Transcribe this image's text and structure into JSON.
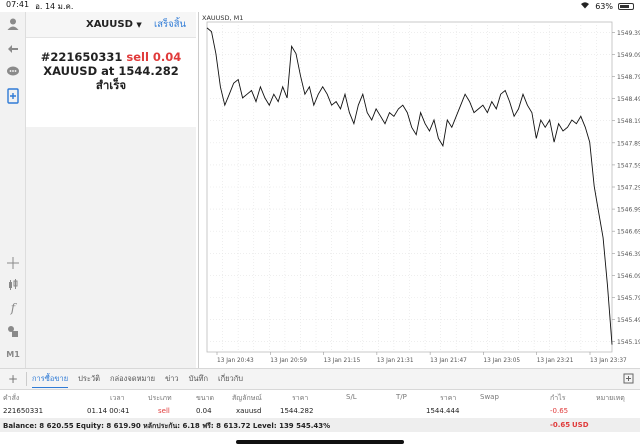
{
  "status_bar": {
    "time": "07:41",
    "date": "อ. 14 ม.ค.",
    "battery": "63%"
  },
  "order_panel": {
    "symbol": "XAUUSD",
    "done_label": "เสร็จสิ้น",
    "ticket": "#221650331",
    "action": "sell 0.04",
    "symbol_at": "XAUUSD at",
    "price": "1544.282",
    "status": "สำเร็จ"
  },
  "tools": {
    "icons": [
      "account-icon",
      "trade-icon",
      "chat-icon",
      "new-order-icon",
      "crosshair-icon",
      "candles-icon",
      "indicators-icon",
      "objects-icon",
      "timeframe-icon"
    ],
    "timeframe": "M1"
  },
  "chart": {
    "title": "XAUUSD, M1",
    "price_labels": [
      "1549.390",
      "1549.090",
      "1548.790",
      "1548.490",
      "1548.190",
      "1547.890",
      "1547.590",
      "1547.290",
      "1546.990",
      "1546.690",
      "1546.390",
      "1546.090",
      "1545.790",
      "1545.490",
      "1545.190"
    ],
    "time_labels": [
      "13 Jan 20:43",
      "13 Jan 20:59",
      "13 Jan 21:15",
      "13 Jan 21:31",
      "13 Jan 21:47",
      "13 Jan 23:05",
      "13 Jan 23:21",
      "13 Jan 23:37"
    ]
  },
  "chart_data": {
    "type": "line",
    "title": "XAUUSD, M1",
    "xlabel": "",
    "ylabel": "",
    "ylim": [
      1545.05,
      1549.53
    ],
    "grid": true,
    "categories": [
      "13 Jan 20:43",
      "13 Jan 20:59",
      "13 Jan 21:15",
      "13 Jan 21:31",
      "13 Jan 21:47",
      "13 Jan 23:05",
      "13 Jan 23:21",
      "13 Jan 23:37"
    ],
    "series": [
      {
        "values": [
          1549.45,
          1549.4,
          1549.1,
          1548.65,
          1548.4,
          1548.55,
          1548.7,
          1548.75,
          1548.5,
          1548.55,
          1548.6,
          1548.45,
          1548.65,
          1548.5,
          1548.4,
          1548.55,
          1548.45,
          1548.65,
          1548.5,
          1549.2,
          1549.1,
          1548.8,
          1548.55,
          1548.65,
          1548.4,
          1548.55,
          1548.65,
          1548.55,
          1548.4,
          1548.45,
          1548.35,
          1548.55,
          1548.3,
          1548.15,
          1548.4,
          1548.55,
          1548.3,
          1548.2,
          1548.35,
          1548.25,
          1548.15,
          1548.3,
          1548.25,
          1548.35,
          1548.4,
          1548.3,
          1548.1,
          1548.0,
          1548.3,
          1548.15,
          1548.05,
          1548.2,
          1547.95,
          1547.85,
          1548.2,
          1548.1,
          1548.25,
          1548.4,
          1548.55,
          1548.45,
          1548.3,
          1548.35,
          1548.4,
          1548.3,
          1548.45,
          1548.35,
          1548.55,
          1548.6,
          1548.45,
          1548.25,
          1548.35,
          1548.55,
          1548.4,
          1548.3,
          1547.95,
          1548.2,
          1548.1,
          1548.2,
          1547.9,
          1548.15,
          1548.05,
          1548.1,
          1548.2,
          1548.15,
          1548.25,
          1548.1,
          1547.9,
          1547.3,
          1546.95,
          1546.6,
          1545.95,
          1545.15
        ]
      }
    ]
  },
  "terminal": {
    "tabs": [
      "การซื้อขาย",
      "ประวัติ",
      "กล่องจดหมาย",
      "ข่าว",
      "บันทึก",
      "เกี่ยวกับ"
    ],
    "active_tab": 0,
    "columns": [
      "คำสั่ง",
      "เวลา",
      "ประเภท",
      "ขนาด",
      "สัญลักษณ์",
      "ราคา",
      "S/L",
      "T/P",
      "ราคา",
      "Swap",
      "กำไร",
      "หมายเหตุ"
    ],
    "row": {
      "order": "221650331",
      "time": "01.14 00:41",
      "type": "sell",
      "size": "0.04",
      "symbol": "xauusd",
      "price": "1544.282",
      "sl": "",
      "tp": "",
      "current": "1544.444",
      "swap": "",
      "profit": "-0.65",
      "comment": ""
    },
    "balance_text": "Balance: 8 620.55 Equity: 8 619.90 หลักประกัน: 6.18 ฟรี: 8 613.72 Level: 139 545.43%",
    "total_profit": "-0.65",
    "currency": "USD"
  },
  "colors": {
    "accent": "#2f7bd6",
    "sell": "#e03b3b"
  }
}
